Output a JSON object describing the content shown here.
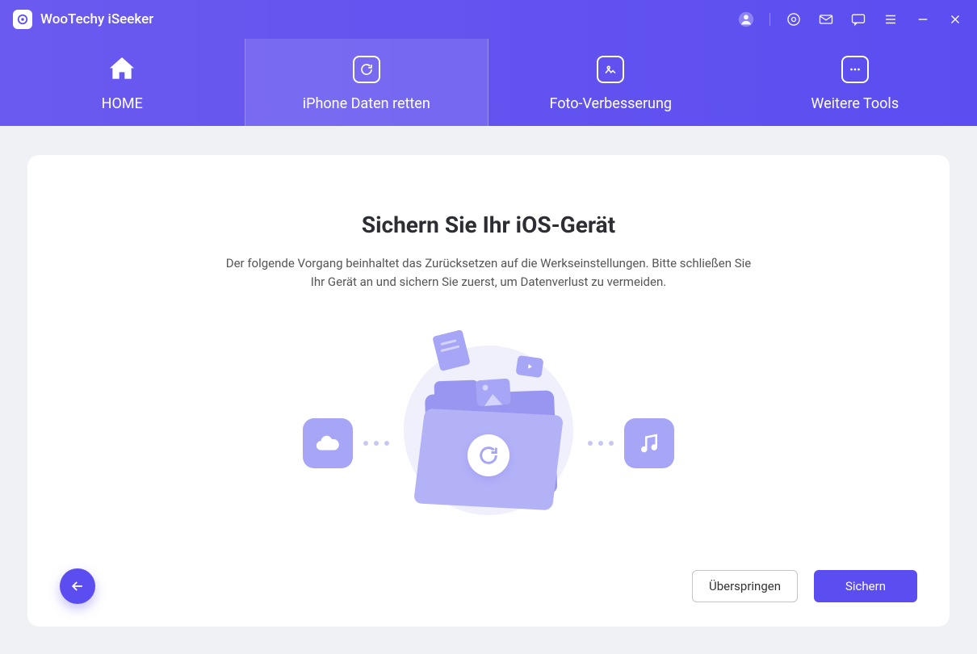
{
  "app": {
    "title": "WooTechy iSeeker"
  },
  "titlebar_icons": {
    "account": "account-icon",
    "settings": "gear-icon",
    "mail": "mail-icon",
    "feedback": "chat-icon",
    "menu": "menu-icon",
    "minimize": "minimize-icon",
    "close": "close-icon"
  },
  "tabs": {
    "home": {
      "label": "HOME"
    },
    "rescue": {
      "label": "iPhone Daten retten"
    },
    "photo": {
      "label": "Foto-Verbesserung"
    },
    "more": {
      "label": "Weitere Tools"
    },
    "active": "rescue"
  },
  "main": {
    "heading": "Sichern Sie Ihr iOS-Gerät",
    "description_line1": "Der folgende Vorgang beinhaltet das Zurücksetzen auf die Werkseinstellungen. Bitte schließen Sie",
    "description_line2": "Ihr Gerät an und sichern Sie zuerst, um Datenverlust zu vermeiden."
  },
  "illustration": {
    "left_box_icon": "cloud-icon",
    "right_box_icon": "music-icon",
    "center_icon": "refresh-icon",
    "float_doc": "document-icon",
    "float_photo": "photo-icon",
    "float_video": "video-icon"
  },
  "buttons": {
    "back": "back-arrow-icon",
    "skip": "Überspringen",
    "backup": "Sichern"
  },
  "colors": {
    "primary": "#5b4df0",
    "gradient_start": "#6b5aef",
    "gradient_end": "#5b4df0",
    "illustration_light": "#b3b2f7",
    "illustration_mid": "#a6a5f6",
    "illustration_dark": "#9896f0"
  }
}
